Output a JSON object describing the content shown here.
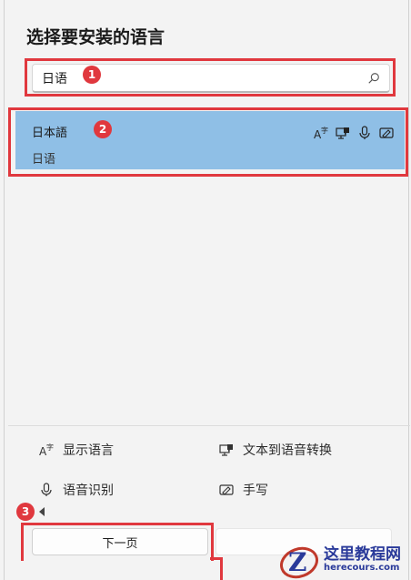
{
  "dialog": {
    "title": "选择要安装的语言"
  },
  "search": {
    "value": "日语",
    "icon": "search-icon"
  },
  "languages": [
    {
      "native_name": "日本語",
      "localized_name": "日语",
      "features": [
        "display-language-icon",
        "text-to-speech-icon",
        "speech-recognition-icon",
        "handwriting-icon"
      ],
      "selected": true
    }
  ],
  "legend": {
    "display_language": "显示语言",
    "text_to_speech": "文本到语音转换",
    "speech_recognition": "语音识别",
    "handwriting": "手写"
  },
  "buttons": {
    "next": "下一页"
  },
  "annotations": {
    "badge_1": "1",
    "badge_2": "2",
    "badge_3": "3",
    "highlight_color": "#e0383e"
  },
  "watermark": {
    "logo_letter": "Z",
    "title": "这里教程网",
    "url": "herecours.com"
  },
  "colors": {
    "selected_item": "#8fbfe6",
    "background": "#f3f3f3"
  }
}
